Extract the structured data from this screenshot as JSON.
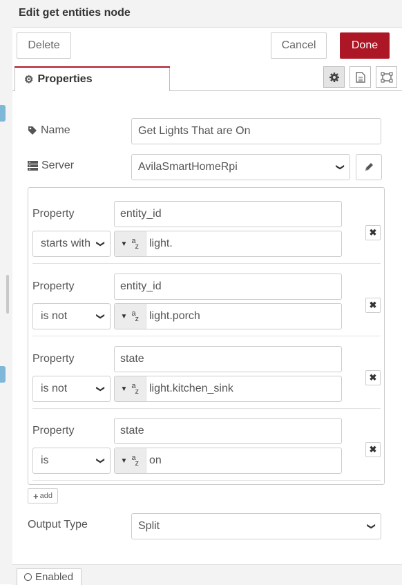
{
  "dialog": {
    "title": "Edit get entities node",
    "delete_label": "Delete",
    "cancel_label": "Cancel",
    "done_label": "Done",
    "accent_color": "#ad1625"
  },
  "tabs": {
    "properties_label": "Properties",
    "icons": [
      "gear-icon",
      "description-icon",
      "appearance-icon"
    ]
  },
  "form": {
    "name_label": "Name",
    "name_value": "Get Lights That are On",
    "server_label": "Server",
    "server_value": "AvilaSmartHomeRpi",
    "output_type_label": "Output Type",
    "output_type_value": "Split",
    "add_label": "add"
  },
  "rules": [
    {
      "label": "Property",
      "property": "entity_id",
      "operator": "starts with",
      "value": "light."
    },
    {
      "label": "Property",
      "property": "entity_id",
      "operator": "is not",
      "value": "light.porch"
    },
    {
      "label": "Property",
      "property": "state",
      "operator": "is not",
      "value": "light.kitchen_sink"
    },
    {
      "label": "Property",
      "property": "state",
      "operator": "is",
      "value": "on"
    }
  ],
  "footer": {
    "enabled_label": "Enabled"
  }
}
